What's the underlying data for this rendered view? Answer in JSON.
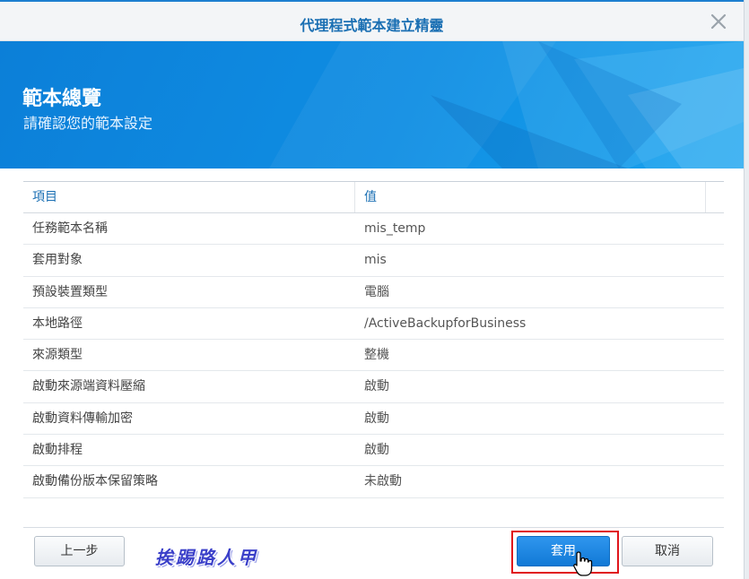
{
  "dialog": {
    "title": "代理程式範本建立精靈",
    "close_icon": "close-icon"
  },
  "banner": {
    "title": "範本總覽",
    "subtitle": "請確認您的範本設定"
  },
  "table": {
    "headers": [
      "項目",
      "值"
    ],
    "rows": [
      {
        "item": "任務範本名稱",
        "value": "mis_temp"
      },
      {
        "item": "套用對象",
        "value": "mis"
      },
      {
        "item": "預設裝置類型",
        "value": "電腦"
      },
      {
        "item": "本地路徑",
        "value": "/ActiveBackupforBusiness"
      },
      {
        "item": "來源類型",
        "value": "整機"
      },
      {
        "item": "啟動來源端資料壓縮",
        "value": "啟動"
      },
      {
        "item": "啟動資料傳輸加密",
        "value": "啟動"
      },
      {
        "item": "啟動排程",
        "value": "啟動"
      },
      {
        "item": "啟動備份版本保留策略",
        "value": "未啟動"
      }
    ]
  },
  "buttons": {
    "prev": "上一步",
    "apply": "套用",
    "cancel": "取消"
  },
  "watermark": "挨踢路人甲",
  "colors": {
    "accent": "#1a6fb3",
    "banner": "#0f8ee3",
    "primary_button": "#1179d6",
    "highlight": "#e0151b"
  }
}
